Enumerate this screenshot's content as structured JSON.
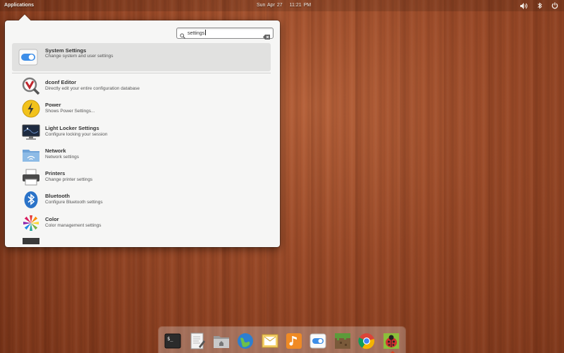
{
  "panel": {
    "applications_label": "Applications",
    "date": "Sun Apr 27",
    "time": "11:21 PM",
    "indicators": [
      "volume-icon",
      "bluetooth-icon",
      "power-icon"
    ]
  },
  "search": {
    "value": "settings",
    "icon": "search-icon",
    "clear_icon": "clear-icon"
  },
  "results": [
    {
      "name": "System Settings",
      "desc": "Change system and user settings",
      "icon": "toggle-icon"
    },
    {
      "name": "dconf Editor",
      "desc": "Directly edit your entire configuration database",
      "icon": "dconf-icon"
    },
    {
      "name": "Power",
      "desc": "Shows Power Settings...",
      "icon": "power-bolt-icon"
    },
    {
      "name": "Light Locker Settings",
      "desc": "Configure locking your session",
      "icon": "monitor-lock-icon"
    },
    {
      "name": "Network",
      "desc": "Network settings",
      "icon": "network-folder-icon"
    },
    {
      "name": "Printers",
      "desc": "Change printer settings",
      "icon": "printer-icon"
    },
    {
      "name": "Bluetooth",
      "desc": "Configure Bluetooth settings",
      "icon": "bluetooth-icon"
    },
    {
      "name": "Color",
      "desc": "Color management settings",
      "icon": "color-icon"
    }
  ],
  "dock": {
    "apps": [
      "terminal-icon",
      "text-editor-icon",
      "files-icon",
      "browser-icon",
      "mail-icon",
      "music-icon",
      "system-settings-icon",
      "minecraft-icon",
      "chrome-icon",
      "ladybug-icon"
    ]
  },
  "colors": {
    "wood": "#9a4a28",
    "popover_bg": "#f6f6f5",
    "selection": "#e1e1e0",
    "toggle_blue": "#3d8ee8"
  }
}
